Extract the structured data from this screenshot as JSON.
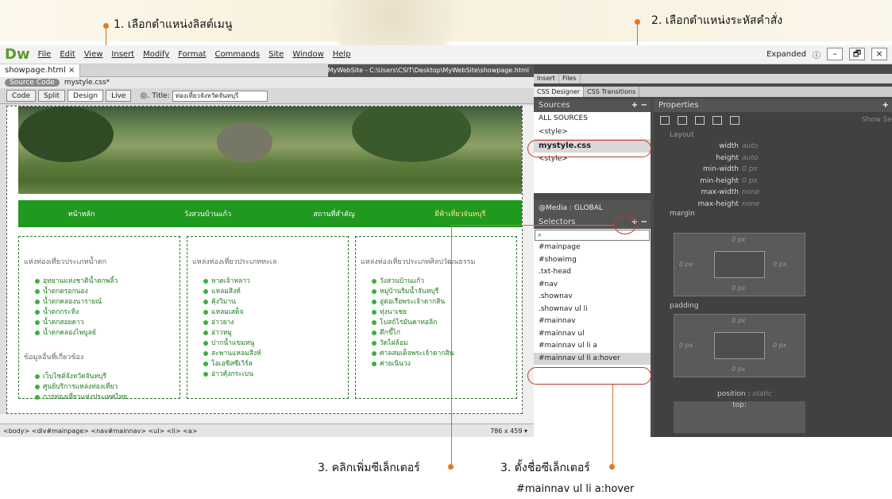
{
  "annotations": {
    "a1": "1. เลือกตำแหน่งลิสต์เมนู",
    "a2": "2. เลือกตำแหน่งระหัสคำสั่ง",
    "a3a": "3. คลิกเพิ่มซีเล็กเตอร์",
    "a3b": "3. ตั้งชื่อซีเล็กเตอร์",
    "a3b_value": "#mainnav ul li a:hover"
  },
  "menubar": {
    "logo": "Dw",
    "items": [
      "File",
      "Edit",
      "View",
      "Insert",
      "Modify",
      "Format",
      "Commands",
      "Site",
      "Window",
      "Help"
    ],
    "workspace": "Expanded",
    "win_buttons": [
      "–",
      "🗗",
      "×"
    ]
  },
  "doc": {
    "tab": "showpage.html ×",
    "path": "MyWebSite - C:\\Users\\CSIT\\Desktop\\MyWebSite\\showpage.html",
    "source_code": "Source Code",
    "css_file": "mystyle.css*",
    "view_buttons": [
      "Code",
      "Split",
      "Design",
      "Live"
    ],
    "title_label": "Title:",
    "title_value": "ท่องเที่ยวจังหวัดจันทบุรี"
  },
  "page": {
    "nav": [
      "หน้าหลัก",
      "วังสวนบ้านแก้ว",
      "สถานที่สำคัญ",
      "ผีฟ้าเที่ยวจันทบุรี"
    ],
    "col1": {
      "heading": "แห่งท่องเที่ยวประเภทน้ำตก",
      "items": [
        "อุทยานแห่งชาติน้ำตกพลิ้ว",
        "น้ำตกตรอกนอง",
        "น้ำตกคลองนารายณ์",
        "น้ำตกกระทิง",
        "น้ำตกสอยดาว",
        "น้ำตกคลองไพบูลย์"
      ],
      "heading2": "ข้อมูลอื่นที่เกี่ยวข้อง",
      "items2": [
        "เว็บไซต์จังหวัดจันทบุรี",
        "ศูนย์บริการแหล่งท่องเที่ยว",
        "การท่องเที่ยวแห่งประเทศไทย"
      ]
    },
    "col2": {
      "heading": "แหล่งท่องเที่ยวประเภททะเล",
      "items": [
        "หาดเจ้าหลาว",
        "แหลมสิงห์",
        "คุ้งวิมาน",
        "แหลมเสด็จ",
        "อ่าวยาง",
        "อ่าวหมู",
        "ปากน้ำแขมหนู",
        "สะพานแหลมสิงห์",
        "โอเอซิสซีเวิร์ล",
        "อ่าวคุ้งกระเบน"
      ]
    },
    "col3": {
      "heading": "แหล่งท่องเที่ยวประเภทศิลปวัฒนธรรม",
      "items": [
        "วังสวนบ้านแก้ว",
        "หมู่บ้านริมน้ำจันทบุรี",
        "อู่ต่อเรือพระเจ้าตากสิน",
        "ทุ่งนาเชย",
        "โบสถ์โรมันคาทอลิก",
        "ตึกขี้ไก่",
        "วัดไผ่ล้อม",
        "ศาลสมเด็จพระเจ้าตากสิน",
        "ค่ายเนินวง"
      ]
    }
  },
  "status": {
    "tags": "<body> <div#mainpage> <nav#mainnav> <ul> <li> <a>",
    "size": "786 x 459 ▾"
  },
  "panel": {
    "tabs": [
      "Insert",
      "Files"
    ],
    "subtabs": [
      "CSS Designer",
      "CSS Transitions"
    ],
    "sources_label": "Sources",
    "sources": [
      "ALL SOURCES",
      "<style>",
      "mystyle.css",
      "<style>"
    ],
    "media": "@Media : GLOBAL",
    "selectors_label": "Selectors",
    "selectors": [
      "#mainpage",
      "#showimg",
      ".txt-head",
      "#nav",
      ".shownav",
      ".shownav ul li",
      "#mainnav",
      "#mainnav ul",
      "#mainnav ul li a",
      "#mainnav ul li a:hover"
    ],
    "properties_label": "Properties",
    "show_set": "Show Se",
    "layout_label": "Layout",
    "props": [
      [
        "width",
        "auto"
      ],
      [
        "height",
        "auto"
      ],
      [
        "min-width",
        "0 px"
      ],
      [
        "min-height",
        "0 px"
      ],
      [
        "max-width",
        "none"
      ],
      [
        "max-height",
        "none"
      ]
    ],
    "margin": "margin",
    "padding": "padding",
    "zero": "0 px",
    "position": "position",
    "position_v": "static",
    "top": "top:"
  }
}
